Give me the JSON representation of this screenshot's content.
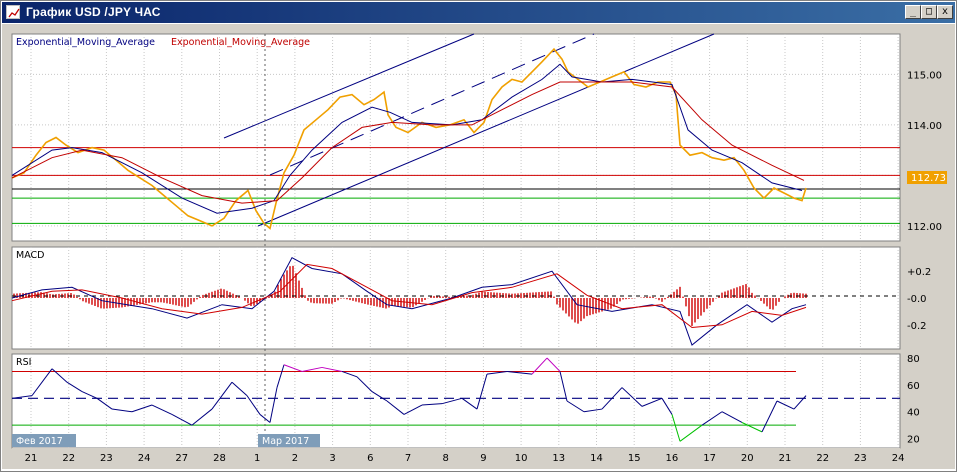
{
  "window": {
    "title": "График USD /JPY  ЧАС",
    "buttons": {
      "minimize": "_",
      "maximize": "□",
      "close": "x"
    }
  },
  "indicators": {
    "ema_label_1": "Exponential_Moving_Average",
    "ema_label_2": "Exponential_Moving_Average",
    "macd_label": "MACD",
    "rsi_label": "RSI"
  },
  "price_axis": {
    "ticks": [
      "115.00",
      "114.00",
      "113.00",
      "112.00"
    ],
    "current_price": "112.73"
  },
  "macd_axis": {
    "ticks": [
      "+0.2",
      "-0.0",
      "-0.2"
    ]
  },
  "rsi_axis": {
    "ticks": [
      "80",
      "60",
      "40",
      "20"
    ]
  },
  "date_axis": {
    "ticks": [
      "21",
      "22",
      "23",
      "24",
      "27",
      "28",
      "1",
      "2",
      "3",
      "6",
      "7",
      "8",
      "9",
      "10",
      "13",
      "14",
      "15",
      "16",
      "17",
      "20",
      "21",
      "22",
      "23",
      "24"
    ],
    "month_labels": [
      "Фев 2017",
      "Мар 2017"
    ]
  },
  "colors": {
    "price": "#f0a000",
    "ema_fast": "#000080",
    "ema_slow": "#c00000",
    "resistance": "#d00000",
    "support": "#00aa00",
    "channel": "#000080",
    "macd_hist": "#d00000",
    "rsi_line": "#000080",
    "rsi_overbought": "#c000c0",
    "rsi_oversold": "#00c000"
  },
  "chart_data": {
    "type": "line",
    "title": "График USD /JPY  ЧАС",
    "ylim": [
      111.7,
      115.8
    ],
    "current_price": 112.73,
    "x_labels": [
      "21",
      "22",
      "23",
      "24",
      "27",
      "28",
      "1",
      "2",
      "3",
      "6",
      "7",
      "8",
      "9",
      "10",
      "13",
      "14",
      "15",
      "16",
      "17",
      "20",
      "21",
      "22",
      "23",
      "24"
    ],
    "price_path": [
      [
        0,
        112.95
      ],
      [
        12,
        113.05
      ],
      [
        24,
        113.4
      ],
      [
        34,
        113.65
      ],
      [
        44,
        113.75
      ],
      [
        54,
        113.6
      ],
      [
        66,
        113.45
      ],
      [
        80,
        113.55
      ],
      [
        92,
        113.5
      ],
      [
        104,
        113.3
      ],
      [
        116,
        113.1
      ],
      [
        128,
        112.95
      ],
      [
        140,
        112.8
      ],
      [
        152,
        112.6
      ],
      [
        164,
        112.4
      ],
      [
        176,
        112.2
      ],
      [
        188,
        112.1
      ],
      [
        200,
        112.0
      ],
      [
        212,
        112.15
      ],
      [
        224,
        112.5
      ],
      [
        236,
        112.7
      ],
      [
        244,
        112.3
      ],
      [
        252,
        112.05
      ],
      [
        258,
        111.95
      ],
      [
        264,
        112.45
      ],
      [
        272,
        113.05
      ],
      [
        282,
        113.4
      ],
      [
        292,
        113.9
      ],
      [
        304,
        114.1
      ],
      [
        316,
        114.3
      ],
      [
        328,
        114.55
      ],
      [
        340,
        114.6
      ],
      [
        352,
        114.4
      ],
      [
        362,
        114.5
      ],
      [
        372,
        114.65
      ],
      [
        376,
        114.2
      ],
      [
        384,
        113.95
      ],
      [
        396,
        113.85
      ],
      [
        410,
        114.05
      ],
      [
        424,
        113.95
      ],
      [
        438,
        114.0
      ],
      [
        452,
        114.1
      ],
      [
        462,
        113.85
      ],
      [
        472,
        114.05
      ],
      [
        480,
        114.5
      ],
      [
        490,
        114.75
      ],
      [
        500,
        114.9
      ],
      [
        510,
        114.85
      ],
      [
        520,
        115.05
      ],
      [
        530,
        115.25
      ],
      [
        542,
        115.5
      ],
      [
        550,
        115.3
      ],
      [
        556,
        115.05
      ],
      [
        566,
        114.9
      ],
      [
        576,
        114.75
      ],
      [
        588,
        114.85
      ],
      [
        600,
        114.95
      ],
      [
        612,
        115.05
      ],
      [
        622,
        114.8
      ],
      [
        634,
        114.75
      ],
      [
        646,
        114.85
      ],
      [
        658,
        114.85
      ],
      [
        664,
        114.6
      ],
      [
        668,
        113.6
      ],
      [
        678,
        113.4
      ],
      [
        690,
        113.45
      ],
      [
        700,
        113.35
      ],
      [
        712,
        113.3
      ],
      [
        722,
        113.35
      ],
      [
        732,
        113.1
      ],
      [
        742,
        112.75
      ],
      [
        752,
        112.55
      ],
      [
        762,
        112.75
      ],
      [
        772,
        112.65
      ],
      [
        782,
        112.55
      ],
      [
        790,
        112.5
      ],
      [
        794,
        112.75
      ]
    ],
    "ema_fast_path": [
      [
        0,
        113.0
      ],
      [
        40,
        113.5
      ],
      [
        60,
        113.55
      ],
      [
        90,
        113.45
      ],
      [
        130,
        113.05
      ],
      [
        170,
        112.55
      ],
      [
        205,
        112.25
      ],
      [
        240,
        112.35
      ],
      [
        262,
        112.5
      ],
      [
        278,
        113.0
      ],
      [
        300,
        113.5
      ],
      [
        330,
        114.05
      ],
      [
        360,
        114.35
      ],
      [
        378,
        114.25
      ],
      [
        400,
        114.05
      ],
      [
        440,
        114.0
      ],
      [
        470,
        114.1
      ],
      [
        500,
        114.55
      ],
      [
        530,
        114.9
      ],
      [
        548,
        115.2
      ],
      [
        560,
        114.95
      ],
      [
        590,
        114.85
      ],
      [
        620,
        114.9
      ],
      [
        660,
        114.8
      ],
      [
        676,
        113.9
      ],
      [
        700,
        113.5
      ],
      [
        730,
        113.25
      ],
      [
        760,
        112.85
      ],
      [
        790,
        112.7
      ]
    ],
    "ema_slow_path": [
      [
        0,
        112.95
      ],
      [
        40,
        113.35
      ],
      [
        70,
        113.5
      ],
      [
        110,
        113.35
      ],
      [
        150,
        112.95
      ],
      [
        190,
        112.6
      ],
      [
        230,
        112.45
      ],
      [
        265,
        112.5
      ],
      [
        290,
        112.95
      ],
      [
        320,
        113.55
      ],
      [
        350,
        113.95
      ],
      [
        380,
        114.05
      ],
      [
        420,
        114.0
      ],
      [
        460,
        114.0
      ],
      [
        490,
        114.3
      ],
      [
        520,
        114.6
      ],
      [
        548,
        114.85
      ],
      [
        580,
        114.85
      ],
      [
        620,
        114.85
      ],
      [
        660,
        114.75
      ],
      [
        690,
        114.1
      ],
      [
        720,
        113.6
      ],
      [
        760,
        113.2
      ],
      [
        792,
        112.9
      ]
    ],
    "horizontal_levels": {
      "resistance": [
        113.55,
        113.0
      ],
      "current": 112.73,
      "support": [
        112.55,
        112.05
      ]
    },
    "macd": {
      "ylim": [
        -0.38,
        0.38
      ],
      "macd_path": [
        [
          0,
          0
        ],
        [
          30,
          0.06
        ],
        [
          60,
          0.08
        ],
        [
          90,
          -0.02
        ],
        [
          140,
          -0.08
        ],
        [
          175,
          -0.15
        ],
        [
          210,
          -0.05
        ],
        [
          240,
          -0.08
        ],
        [
          262,
          0.05
        ],
        [
          280,
          0.3
        ],
        [
          300,
          0.22
        ],
        [
          330,
          0.18
        ],
        [
          355,
          0.05
        ],
        [
          375,
          -0.05
        ],
        [
          400,
          -0.08
        ],
        [
          440,
          0
        ],
        [
          470,
          0.08
        ],
        [
          500,
          0.1
        ],
        [
          540,
          0.2
        ],
        [
          565,
          -0.05
        ],
        [
          600,
          -0.1
        ],
        [
          640,
          -0.05
        ],
        [
          668,
          -0.1
        ],
        [
          680,
          -0.35
        ],
        [
          705,
          -0.2
        ],
        [
          735,
          -0.05
        ],
        [
          760,
          -0.18
        ],
        [
          780,
          -0.08
        ],
        [
          794,
          -0.05
        ]
      ],
      "signal_path": [
        [
          0,
          -0.02
        ],
        [
          40,
          0.05
        ],
        [
          70,
          0.06
        ],
        [
          110,
          0
        ],
        [
          150,
          -0.08
        ],
        [
          190,
          -0.12
        ],
        [
          230,
          -0.07
        ],
        [
          268,
          0.05
        ],
        [
          295,
          0.25
        ],
        [
          320,
          0.22
        ],
        [
          350,
          0.1
        ],
        [
          380,
          -0.02
        ],
        [
          420,
          -0.05
        ],
        [
          460,
          0.04
        ],
        [
          500,
          0.08
        ],
        [
          545,
          0.18
        ],
        [
          575,
          0.02
        ],
        [
          610,
          -0.08
        ],
        [
          650,
          -0.05
        ],
        [
          680,
          -0.22
        ],
        [
          710,
          -0.2
        ],
        [
          740,
          -0.1
        ],
        [
          770,
          -0.13
        ],
        [
          794,
          -0.07
        ]
      ]
    },
    "rsi": {
      "ylim": [
        13,
        83
      ],
      "levels": {
        "overbought": 70,
        "mid": 50,
        "oversold": 30
      },
      "path": [
        [
          0,
          50
        ],
        [
          20,
          52
        ],
        [
          40,
          72
        ],
        [
          55,
          62
        ],
        [
          70,
          55
        ],
        [
          85,
          50
        ],
        [
          100,
          42
        ],
        [
          120,
          40
        ],
        [
          140,
          45
        ],
        [
          160,
          38
        ],
        [
          180,
          30
        ],
        [
          200,
          42
        ],
        [
          220,
          62
        ],
        [
          235,
          52
        ],
        [
          248,
          38
        ],
        [
          258,
          32
        ],
        [
          265,
          58
        ],
        [
          272,
          75
        ],
        [
          290,
          70
        ],
        [
          310,
          73
        ],
        [
          330,
          70
        ],
        [
          345,
          66
        ],
        [
          360,
          55
        ],
        [
          375,
          48
        ],
        [
          392,
          38
        ],
        [
          410,
          45
        ],
        [
          430,
          46
        ],
        [
          450,
          50
        ],
        [
          465,
          42
        ],
        [
          475,
          68
        ],
        [
          495,
          70
        ],
        [
          520,
          68
        ],
        [
          535,
          80
        ],
        [
          548,
          70
        ],
        [
          555,
          48
        ],
        [
          572,
          40
        ],
        [
          590,
          42
        ],
        [
          610,
          58
        ],
        [
          630,
          44
        ],
        [
          650,
          50
        ],
        [
          660,
          38
        ],
        [
          668,
          18
        ],
        [
          690,
          30
        ],
        [
          710,
          40
        ],
        [
          730,
          32
        ],
        [
          750,
          25
        ],
        [
          765,
          48
        ],
        [
          782,
          42
        ],
        [
          794,
          52
        ]
      ]
    }
  }
}
